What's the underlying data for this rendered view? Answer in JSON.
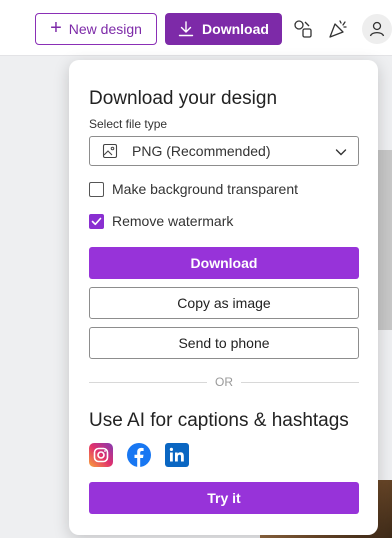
{
  "topbar": {
    "new_design_label": "New design",
    "download_label": "Download"
  },
  "panel": {
    "title": "Download your design",
    "file_type_label": "Select file type",
    "file_type_value": "PNG (Recommended)",
    "bg_transparent_label": "Make background transparent",
    "bg_transparent_checked": false,
    "remove_watermark_label": "Remove watermark",
    "remove_watermark_checked": true,
    "download_button": "Download",
    "copy_button": "Copy as image",
    "send_button": "Send to phone",
    "or_label": "OR",
    "ai_title": "Use AI for captions & hashtags",
    "socials": [
      "instagram-icon",
      "facebook-icon",
      "linkedin-icon"
    ],
    "try_button": "Try it"
  },
  "colors": {
    "brand": "#7d2aa8",
    "primary_button": "#9733d9"
  }
}
